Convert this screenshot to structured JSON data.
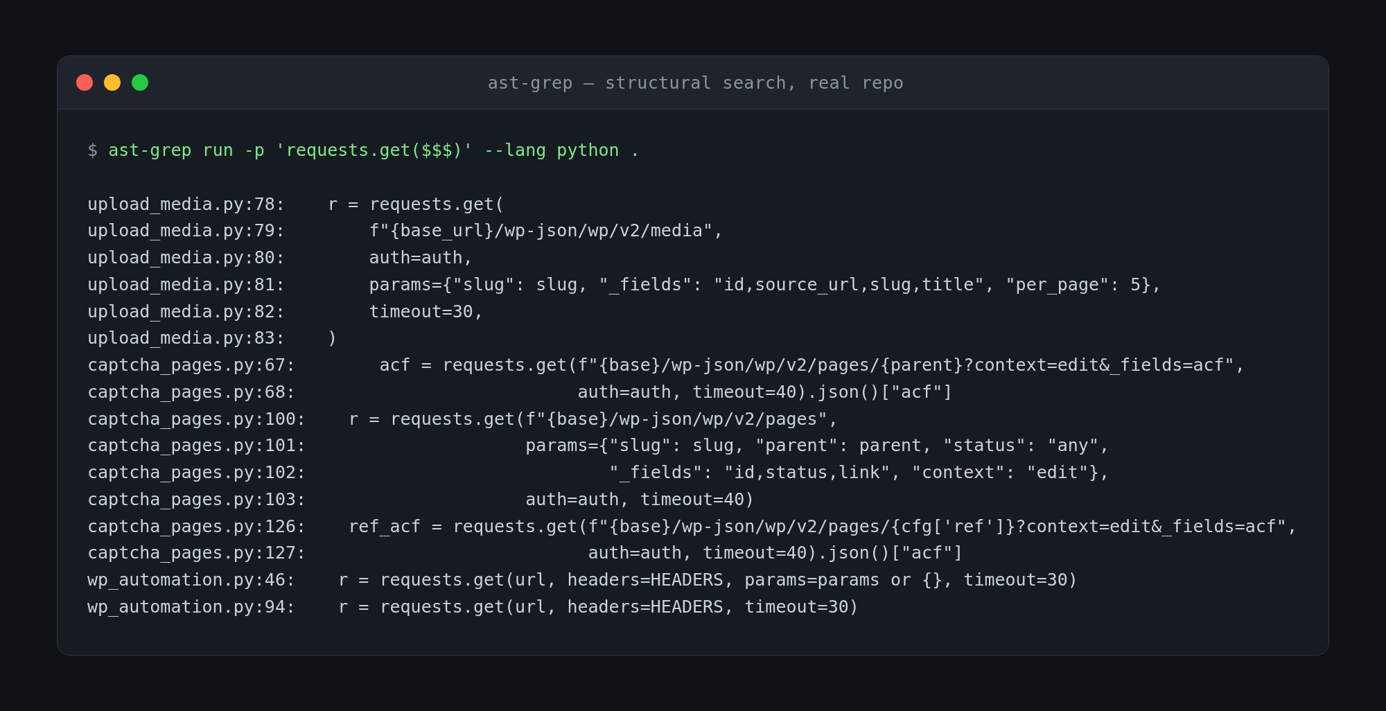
{
  "window": {
    "title": "ast-grep — structural search, real repo"
  },
  "terminal": {
    "prompt": "$",
    "command": "ast-grep run -p 'requests.get($$$)' --lang python .",
    "results": [
      {
        "location": "upload_media.py:78:",
        "code": "    r = requests.get("
      },
      {
        "location": "upload_media.py:79:",
        "code": "        f\"{base_url}/wp-json/wp/v2/media\","
      },
      {
        "location": "upload_media.py:80:",
        "code": "        auth=auth,"
      },
      {
        "location": "upload_media.py:81:",
        "code": "        params={\"slug\": slug, \"_fields\": \"id,source_url,slug,title\", \"per_page\": 5},"
      },
      {
        "location": "upload_media.py:82:",
        "code": "        timeout=30,"
      },
      {
        "location": "upload_media.py:83:",
        "code": "    )"
      },
      {
        "location": "captcha_pages.py:67:",
        "code": "        acf = requests.get(f\"{base}/wp-json/wp/v2/pages/{parent}?context=edit&_fields=acf\","
      },
      {
        "location": "captcha_pages.py:68:",
        "code": "                           auth=auth, timeout=40).json()[\"acf\"]"
      },
      {
        "location": "captcha_pages.py:100:",
        "code": "    r = requests.get(f\"{base}/wp-json/wp/v2/pages\","
      },
      {
        "location": "captcha_pages.py:101:",
        "code": "                     params={\"slug\": slug, \"parent\": parent, \"status\": \"any\","
      },
      {
        "location": "captcha_pages.py:102:",
        "code": "                             \"_fields\": \"id,status,link\", \"context\": \"edit\"},"
      },
      {
        "location": "captcha_pages.py:103:",
        "code": "                     auth=auth, timeout=40)"
      },
      {
        "location": "captcha_pages.py:126:",
        "code": "    ref_acf = requests.get(f\"{base}/wp-json/wp/v2/pages/{cfg['ref']}?context=edit&_fields=acf\","
      },
      {
        "location": "captcha_pages.py:127:",
        "code": "                           auth=auth, timeout=40).json()[\"acf\"]"
      },
      {
        "location": "wp_automation.py:46:",
        "code": "    r = requests.get(url, headers=HEADERS, params=params or {}, timeout=30)"
      },
      {
        "location": "wp_automation.py:94:",
        "code": "    r = requests.get(url, headers=HEADERS, timeout=30)"
      }
    ]
  }
}
